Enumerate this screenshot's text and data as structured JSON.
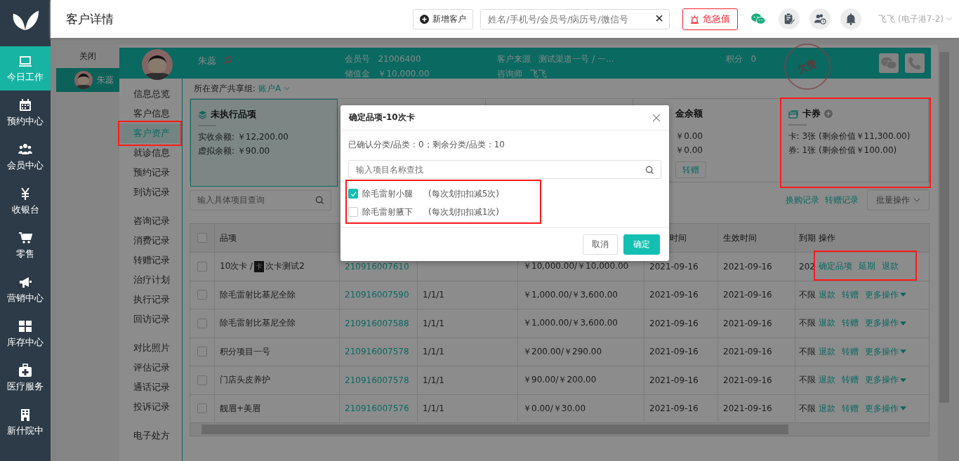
{
  "sidebar": {
    "items": [
      {
        "label": "今日工作",
        "selected": true
      },
      {
        "label": "预约中心",
        "selected": false
      },
      {
        "label": "会员中心",
        "selected": false
      },
      {
        "label": "收银台",
        "selected": false
      },
      {
        "label": "零售",
        "selected": false
      },
      {
        "label": "营销中心",
        "selected": false
      },
      {
        "label": "库存中心",
        "selected": false
      },
      {
        "label": "医疗服务",
        "selected": false
      },
      {
        "label": "新什院中",
        "selected": false
      }
    ]
  },
  "header": {
    "title": "客户详情",
    "add_button": "新增客户",
    "search": {
      "placeholder": "姓名/手机号/会员号/病历号/微信号"
    },
    "alert_button": "危急值",
    "user": "飞飞 (电子港7-2)"
  },
  "customer_tabs": {
    "close": "关闭",
    "items": [
      {
        "name": "朱蕊",
        "selected": true
      }
    ]
  },
  "customer": {
    "name": "朱蕊",
    "fields": [
      {
        "label": "会员号",
        "value": "21006400"
      },
      {
        "label": "储值金",
        "value": "￥10,000.00"
      },
      {
        "label": "客户来源",
        "value": "测试渠道一号 / 一..."
      },
      {
        "label": "咨询师",
        "value": "飞飞"
      },
      {
        "label": "积分",
        "value": "0"
      }
    ],
    "stamp": "欠费"
  },
  "customer_nav": {
    "groups": [
      [
        {
          "label": "信息总览",
          "selected": false,
          "highlighted": false
        },
        {
          "label": "客户信息",
          "selected": false,
          "highlighted": false
        },
        {
          "label": "客户资产",
          "selected": true,
          "highlighted": true
        },
        {
          "label": "就诊信息",
          "selected": false,
          "highlighted": false
        },
        {
          "label": "预约记录",
          "selected": false,
          "highlighted": false
        },
        {
          "label": "到访记录",
          "selected": false,
          "highlighted": false
        }
      ],
      [
        {
          "label": "咨询记录",
          "selected": false,
          "highlighted": false
        },
        {
          "label": "消费记录",
          "selected": false,
          "highlighted": false
        },
        {
          "label": "转赠记录",
          "selected": false,
          "highlighted": false
        },
        {
          "label": "治疗计划",
          "selected": false,
          "highlighted": false
        },
        {
          "label": "执行记录",
          "selected": false,
          "highlighted": false
        },
        {
          "label": "回访记录",
          "selected": false,
          "highlighted": false
        }
      ],
      [
        {
          "label": "对比照片",
          "selected": false,
          "highlighted": false
        },
        {
          "label": "评估记录",
          "selected": false,
          "highlighted": false
        },
        {
          "label": "通话记录",
          "selected": false,
          "highlighted": false
        },
        {
          "label": "投诉记录",
          "selected": false,
          "highlighted": false
        }
      ],
      [
        {
          "label": "电子处方",
          "selected": false,
          "highlighted": false
        }
      ]
    ]
  },
  "share_group": {
    "label": "所在资产共享组:",
    "value": "账户A"
  },
  "cards": [
    {
      "kind": "items",
      "title": "未执行品项",
      "lines": [
        "实收余额: ￥12,200.00",
        "虚拟余额: ￥90.00"
      ]
    },
    {
      "kind": "covered"
    },
    {
      "kind": "covered"
    },
    {
      "kind": "deposit",
      "title": "金余额",
      "lines": [
        "￥0.00",
        "￥0.00"
      ],
      "buttons": [
        "转赠"
      ]
    },
    {
      "kind": "coupon",
      "title": "卡券",
      "lines": [
        "卡: 3张 (剩余价值￥11,300.00)",
        "券: 1张 (剩余价值￥100.00)"
      ],
      "highlighted": true
    }
  ],
  "toolbar": {
    "search": {
      "placeholder": "输入具体项目查询"
    },
    "links": [
      "换购记录",
      "转赠记录"
    ],
    "batch_button": "批量操作"
  },
  "table": {
    "all_checked": false,
    "columns": [
      "品项",
      null,
      null,
      null,
      "时间",
      "生效时间",
      "到期",
      "操作"
    ],
    "rows": [
      {
        "checked": false,
        "item": "10次卡 /",
        "tag": "卡",
        "item_suffix": "次卡测试2",
        "order": "210916007610",
        "amount": "￥10,000.00/￥10,000.00",
        "time": "2021-09-16",
        "effective": "2021-09-16",
        "expiry": "202",
        "actions": [
          "确定品项",
          "延期",
          "退款"
        ],
        "more": false,
        "highlighted": true
      },
      {
        "checked": false,
        "item": "除毛雷射比基尼全除",
        "order": "210916007590",
        "count": "1/1/1",
        "amount": "￥1,000.00/￥3,600.00",
        "time": "2021-09-16",
        "effective": "2021-09-16",
        "expiry": "不限",
        "actions": [
          "退款",
          "转赠",
          "更多操作"
        ],
        "more": true
      },
      {
        "checked": false,
        "item": "除毛雷射比基尼全除",
        "order": "210916007588",
        "count": "1/1/1",
        "amount": "￥1,000.00/￥3,600.00",
        "time": "2021-09-16",
        "effective": "2021-09-16",
        "expiry": "不限",
        "actions": [
          "退款",
          "转赠",
          "更多操作"
        ],
        "more": true
      },
      {
        "checked": false,
        "item": "积分项目一号",
        "order": "210916007578",
        "count": "1/1/1",
        "amount": "￥200.00/￥290.00",
        "time": "2021-09-16",
        "effective": "2021-09-16",
        "expiry": "不限",
        "actions": [
          "退款",
          "转赠",
          "更多操作"
        ],
        "more": true
      },
      {
        "checked": false,
        "item": "门店头皮养护",
        "order": "210916007578",
        "count": "1/1/1",
        "amount": "￥90.00/￥200.00",
        "time": "2021-09-16",
        "effective": "2021-09-16",
        "expiry": "不限",
        "actions": [
          "退款",
          "转赠",
          "更多操作"
        ],
        "more": true
      },
      {
        "checked": false,
        "item": "靓眉+美眉",
        "order": "210916007576",
        "count": "1/1/1",
        "amount": "￥0.00/￥30.00",
        "time": "2021-09-16",
        "effective": "2021-09-16",
        "expiry": "不限",
        "actions": [
          "退款",
          "转赠",
          "更多操作"
        ],
        "more": true
      }
    ]
  },
  "dialog": {
    "title": "确定品项-10次卡",
    "summary": "已确认分类/品类：0；剩余分类/品类：10",
    "search": {
      "placeholder": "输入项目名称查找"
    },
    "options_highlighted": true,
    "options": [
      {
        "name": "除毛雷射小腿",
        "note": "(每次划扣扣减5次)",
        "checked": true
      },
      {
        "name": "除毛雷射腋下",
        "note": "(每次划扣扣减1次)",
        "checked": false
      }
    ],
    "cancel_button": "取消",
    "confirm_button": "确定"
  }
}
